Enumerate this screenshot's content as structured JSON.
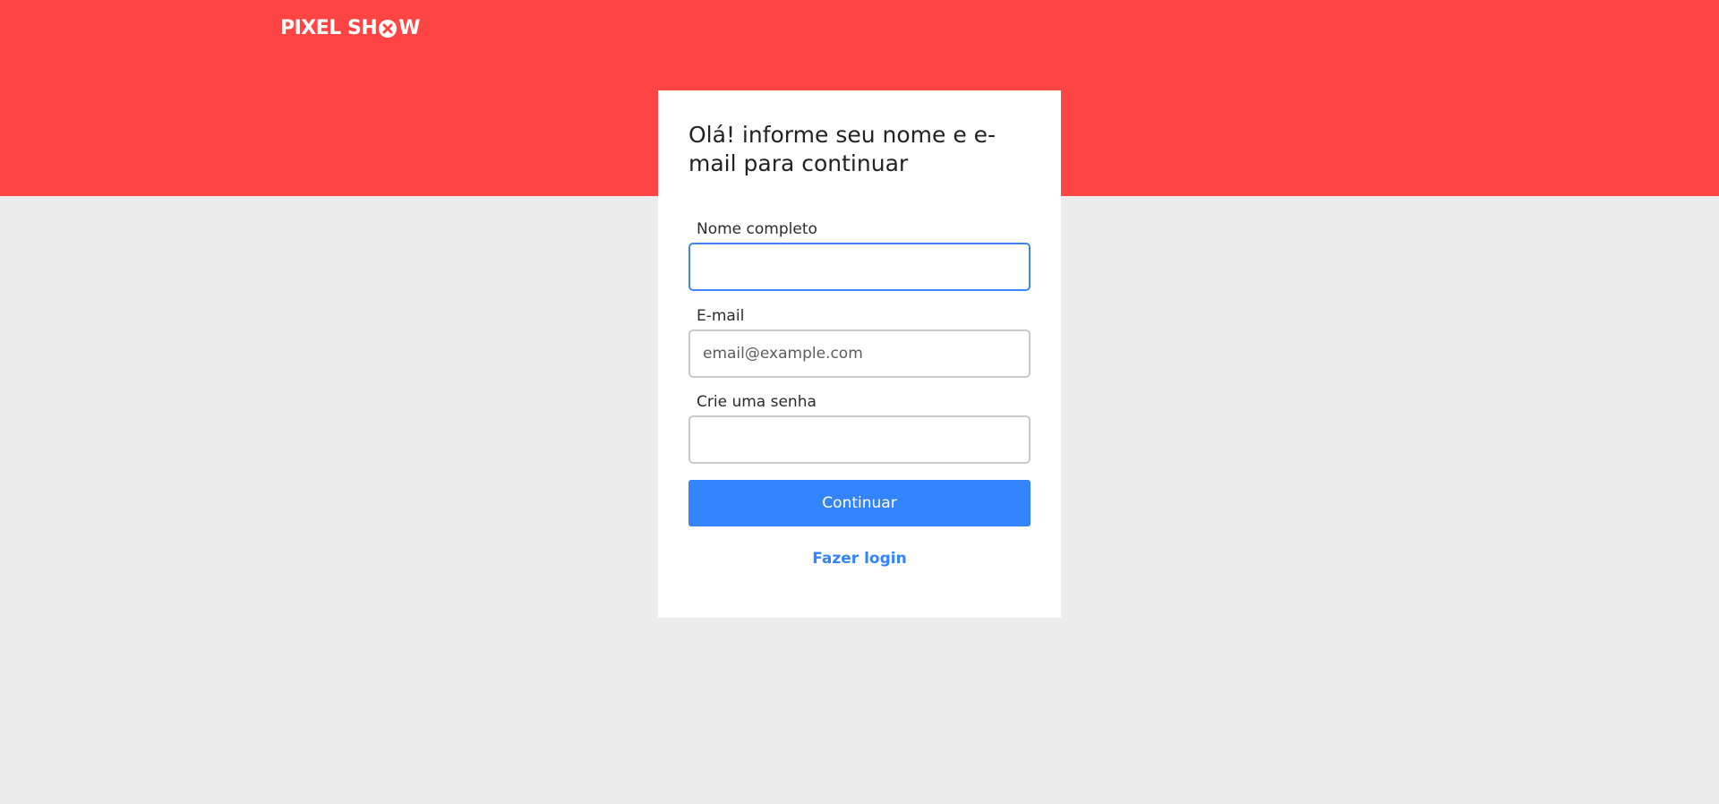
{
  "header": {
    "brand_part1": "PIXEL SH",
    "brand_part2": "W",
    "brand_color": "#ff4544"
  },
  "form": {
    "title": "Olá! informe seu nome e e-mail para continuar",
    "name_label": "Nome completo",
    "name_value": "",
    "name_placeholder": "",
    "email_label": "E-mail",
    "email_value": "",
    "email_placeholder": "email@example.com",
    "password_label": "Crie uma senha",
    "password_value": "",
    "password_placeholder": "",
    "submit_label": "Continuar",
    "login_link_label": "Fazer login"
  },
  "colors": {
    "accent": "#3384fb",
    "background": "#ececec",
    "focus_border": "#3f86f5"
  },
  "icons": {
    "logo_mark": "x-circle-icon"
  }
}
